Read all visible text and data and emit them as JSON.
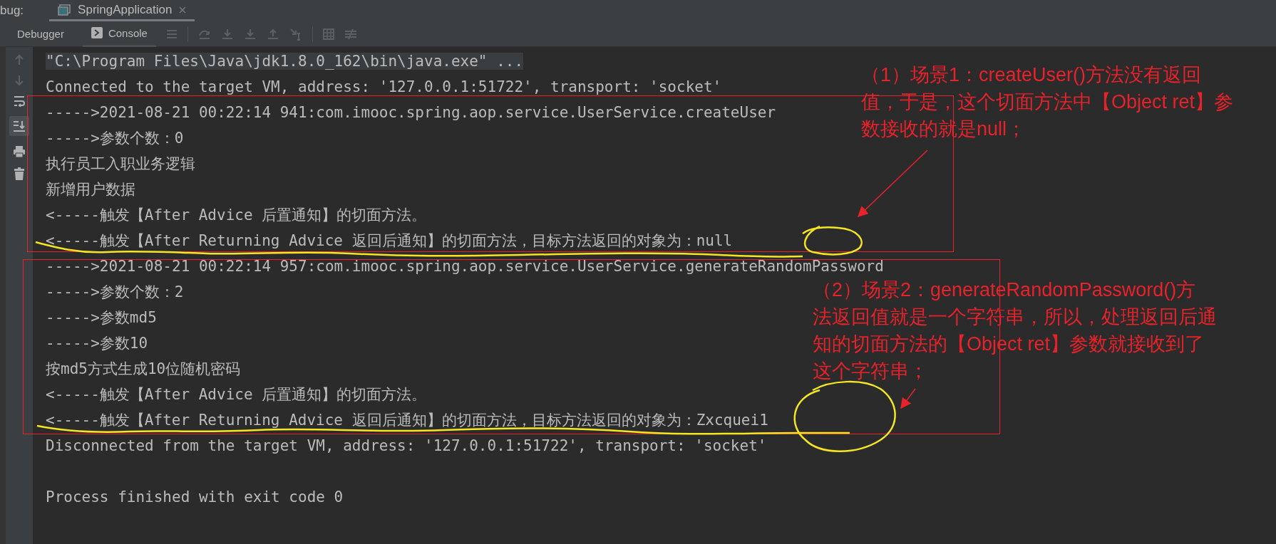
{
  "header": {
    "label": "bug:",
    "tabs": [
      {
        "label": "SpringApplication",
        "selected": true
      }
    ]
  },
  "toolbar": {
    "tabs": [
      {
        "label": "Debugger",
        "selected": false
      },
      {
        "label": "Console",
        "selected": true
      }
    ]
  },
  "console": {
    "lines": [
      {
        "kind": "text",
        "text": "\"C:\\Program Files\\Java\\jdk1.8.0_162\\bin\\java.exe\" ...",
        "highlighted": true
      },
      {
        "kind": "text",
        "text": "Connected to the target VM, address: '127.0.0.1:51722', transport: 'socket'",
        "highlighted": false
      },
      {
        "kind": "text",
        "text": "----->2021-08-21 00:22:14 941:com.imooc.spring.aop.service.UserService.createUser",
        "highlighted": false
      },
      {
        "kind": "text",
        "text": "----->参数个数：0",
        "highlighted": false
      },
      {
        "kind": "text",
        "text": "执行员工入职业务逻辑",
        "highlighted": false
      },
      {
        "kind": "text",
        "text": "新增用户数据",
        "highlighted": false
      },
      {
        "kind": "text",
        "text": "<-----触发【After Advice 后置通知】的切面方法。",
        "highlighted": false
      },
      {
        "kind": "text",
        "text": "<-----触发【After Returning Advice 返回后通知】的切面方法，目标方法返回的对象为：null",
        "highlighted": false
      },
      {
        "kind": "text",
        "text": "----->2021-08-21 00:22:14 957:com.imooc.spring.aop.service.UserService.generateRandomPassword",
        "highlighted": false
      },
      {
        "kind": "text",
        "text": "----->参数个数：2",
        "highlighted": false
      },
      {
        "kind": "text",
        "text": "----->参数md5",
        "highlighted": false
      },
      {
        "kind": "text",
        "text": "----->参数10",
        "highlighted": false
      },
      {
        "kind": "text",
        "text": "按md5方式生成10位随机密码",
        "highlighted": false
      },
      {
        "kind": "text",
        "text": "<-----触发【After Advice 后置通知】的切面方法。",
        "highlighted": false
      },
      {
        "kind": "text",
        "text": "<-----触发【After Returning Advice 返回后通知】的切面方法，目标方法返回的对象为：Zxcquei1",
        "highlighted": false
      },
      {
        "kind": "text",
        "text": "Disconnected from the target VM, address: '127.0.0.1:51722', transport: 'socket'",
        "highlighted": false
      },
      {
        "kind": "blank"
      },
      {
        "kind": "text",
        "text": "Process finished with exit code 0",
        "highlighted": false
      }
    ]
  },
  "annotations": [
    {
      "lines": [
        "（1）场景1：createUser()方法没有返回",
        "值，于是，这个切面方法中【Object ret】参",
        "数接收的就是null；"
      ]
    },
    {
      "lines": [
        "（2）场景2：generateRandomPassword()方",
        "法返回值就是一个字符串，所以，处理返回后通",
        "知的切面方法的【Object ret】参数就接收到了",
        "这个字符串；"
      ]
    }
  ]
}
